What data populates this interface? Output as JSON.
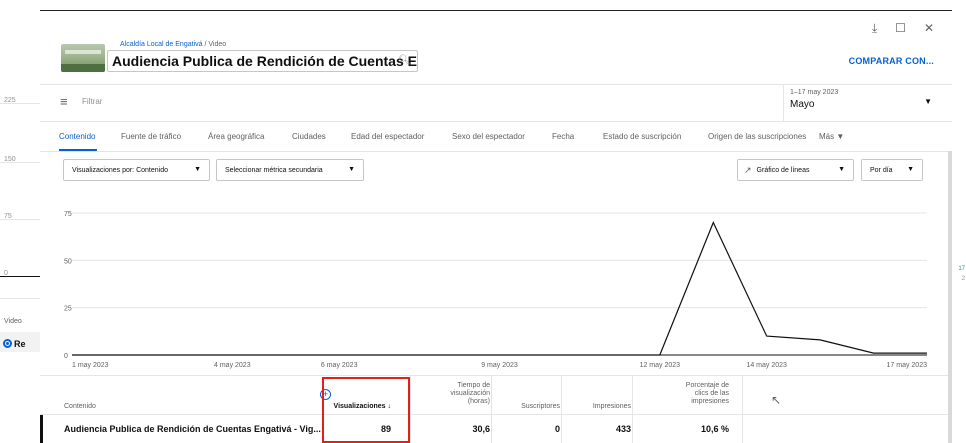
{
  "background": {
    "ticks": [
      "225",
      "150",
      "75",
      "0"
    ],
    "section_label": "Video",
    "row_prefix": "Re",
    "right_ticks": [
      "17",
      "2"
    ]
  },
  "header": {
    "channel": "Alcaldía Local de Engativá",
    "separator": " / ",
    "section": "Video",
    "video_title": "Audiencia Publica de Rendición de Cuentas Engativ…",
    "compare_label": "COMPARAR CON...",
    "icons": [
      "download-icon",
      "feedback-icon",
      "close-icon"
    ]
  },
  "filter": {
    "label": "Filtrar",
    "icon": "filter-icon"
  },
  "date": {
    "range": "1–17 may 2023",
    "label": "Mayo"
  },
  "tabs": [
    "Contenido",
    "Fuente de tráfico",
    "Área geográfica",
    "Ciudades",
    "Edad del espectador",
    "Sexo del espectador",
    "Fecha",
    "Estado de suscripción",
    "Origen de las suscripciones",
    "Más"
  ],
  "controls": {
    "views_by": "Visualizaciones por: Contenido",
    "secondary_metric": "Seleccionar métrica secundaria",
    "chart_type": "Gráfico de líneas",
    "granularity": "Por día"
  },
  "chart_data": {
    "type": "line",
    "y_ticks": [
      "0",
      "25",
      "50",
      "75"
    ],
    "ylim": [
      0,
      75
    ],
    "x_labels": [
      "1 may 2023",
      "4 may 2023",
      "6 may 2023",
      "9 may 2023",
      "12 may 2023",
      "14 may 2023",
      "17 may 2023"
    ],
    "x_label_days": [
      1,
      4,
      6,
      9,
      12,
      14,
      17
    ],
    "series": [
      {
        "days": [
          1,
          12,
          13,
          14,
          15,
          16,
          17
        ],
        "values": [
          0,
          0,
          70,
          10,
          8,
          1,
          1
        ]
      }
    ],
    "color": "#0f0f0f"
  },
  "table": {
    "headers": {
      "content": "Contenido",
      "views": "Visualizaciones",
      "watch_time": [
        "Tiempo de",
        "visualización",
        "(horas)"
      ],
      "subscribers": "Suscriptores",
      "impressions": "Impresiones",
      "ctr": [
        "Porcentaje de",
        "clics de las",
        "impresiones"
      ]
    },
    "row": {
      "title": "Audiencia Publica de Rendición de Cuentas Engativá - Vig...",
      "views": "89",
      "watch_time": "30,6",
      "subscribers": "0",
      "impressions": "433",
      "ctr": "10,6 %"
    }
  }
}
